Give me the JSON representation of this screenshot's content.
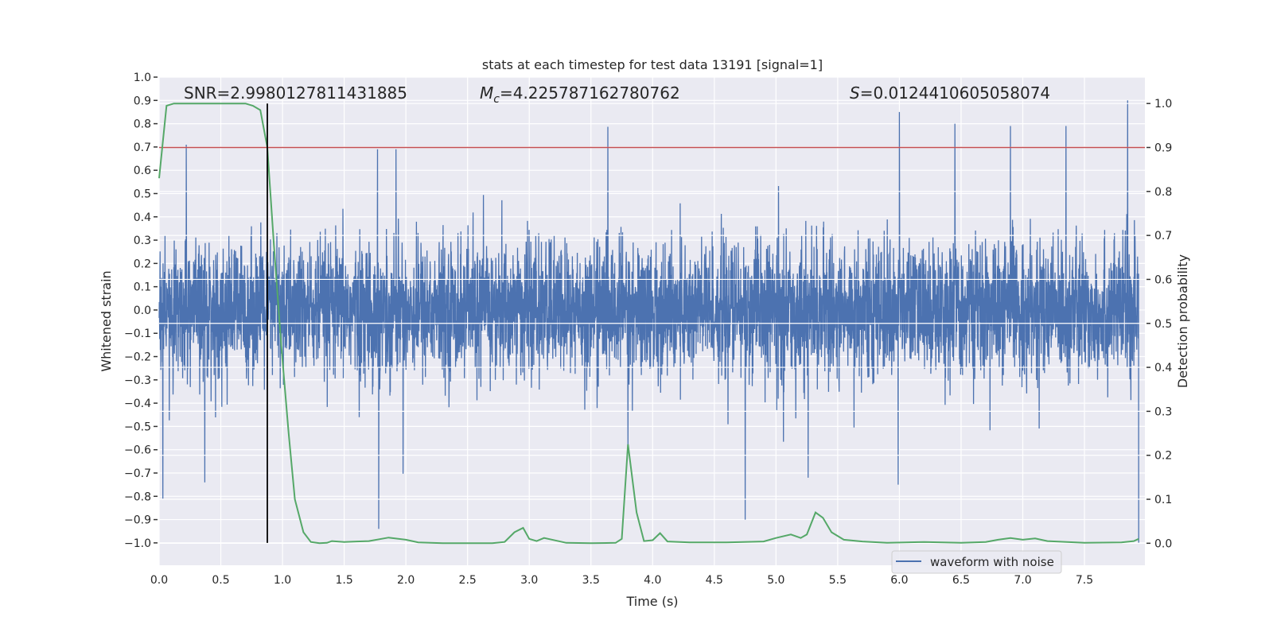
{
  "chart_data": {
    "type": "line",
    "title": "stats at each timestep for test data 13191 [signal=1]",
    "xlabel": "Time (s)",
    "ylabel_left": "Whitened strain",
    "ylabel_right": "Detection probability",
    "xlim": [
      0,
      7.99
    ],
    "ylim_left": [
      -1.096,
      1.0
    ],
    "ylim_right": [
      -0.05,
      1.06
    ],
    "x_ticks": [
      "0.0",
      "0.5",
      "1.0",
      "1.5",
      "2.0",
      "2.5",
      "3.0",
      "3.5",
      "4.0",
      "4.5",
      "5.0",
      "5.5",
      "6.0",
      "6.5",
      "7.0",
      "7.5"
    ],
    "y_ticks_left": [
      "1.0",
      "0.9",
      "0.8",
      "0.7",
      "0.6",
      "0.5",
      "0.4",
      "0.3",
      "0.2",
      "0.1",
      "0.0",
      "−0.1",
      "−0.2",
      "−0.3",
      "−0.4",
      "−0.5",
      "−0.6",
      "−0.7",
      "−0.8",
      "−0.9",
      "−1.0"
    ],
    "y_ticks_right": [
      "1.0",
      "0.9",
      "0.8",
      "0.7",
      "0.6",
      "0.5",
      "0.4",
      "0.3",
      "0.2",
      "0.1",
      "0.0"
    ],
    "grid": true,
    "annotations": {
      "snr": "SNR=2.9980127811431885",
      "mc_symbol": "M",
      "mc_sub": "c",
      "mc_value": "=4.225787162780762",
      "s_symbol": "S",
      "s_value": "=0.0124410605058074"
    },
    "legend": {
      "placement": "lower-right",
      "entries": [
        "waveform with noise"
      ]
    },
    "colors": {
      "waveform": "#4c72b0",
      "probability": "#55a868",
      "threshold": "#c44e52",
      "marker": "#000000",
      "plot_bg": "#eaeaf2"
    },
    "threshold_probability": 0.9,
    "marker_time": 0.877,
    "waveform": {
      "name": "waveform with noise",
      "typical_band": [
        -0.33,
        0.33
      ],
      "notable_peaks": [
        {
          "t": 0.03,
          "v": -0.81
        },
        {
          "t": 0.22,
          "v": 0.71
        },
        {
          "t": 0.37,
          "v": -0.74
        },
        {
          "t": 1.78,
          "v": -0.94
        },
        {
          "t": 1.77,
          "v": 0.69
        },
        {
          "t": 1.92,
          "v": 0.69
        },
        {
          "t": 3.8,
          "v": -0.6
        },
        {
          "t": 4.75,
          "v": -0.9
        },
        {
          "t": 5.26,
          "v": -0.72
        },
        {
          "t": 6.0,
          "v": 0.85
        },
        {
          "t": 5.99,
          "v": -0.75
        },
        {
          "t": 6.45,
          "v": 0.8
        },
        {
          "t": 6.9,
          "v": 0.79
        },
        {
          "t": 7.35,
          "v": 0.79
        },
        {
          "t": 7.85,
          "v": 0.9
        },
        {
          "t": 7.94,
          "v": -1.0
        }
      ]
    },
    "detection_probability": {
      "t": [
        0.0,
        0.06,
        0.12,
        0.7,
        0.76,
        0.82,
        0.877,
        0.93,
        0.99,
        1.05,
        1.1,
        1.17,
        1.23,
        1.3,
        1.36,
        1.4,
        1.5,
        1.6,
        1.7,
        1.86,
        2.0,
        2.1,
        2.3,
        2.5,
        2.7,
        2.8,
        2.88,
        2.95,
        3.0,
        3.06,
        3.12,
        3.3,
        3.5,
        3.7,
        3.75,
        3.8,
        3.87,
        3.93,
        4.0,
        4.06,
        4.12,
        4.3,
        4.6,
        4.9,
        5.0,
        5.12,
        5.2,
        5.25,
        5.32,
        5.38,
        5.45,
        5.55,
        5.7,
        5.9,
        6.2,
        6.5,
        6.7,
        6.8,
        6.9,
        7.0,
        7.1,
        7.2,
        7.5,
        7.8,
        7.9,
        7.94
      ],
      "p": [
        0.83,
        0.995,
        1.0,
        1.0,
        0.995,
        0.985,
        0.9,
        0.68,
        0.45,
        0.25,
        0.1,
        0.025,
        0.003,
        0.0,
        0.001,
        0.005,
        0.003,
        0.004,
        0.005,
        0.013,
        0.008,
        0.002,
        0.0,
        0.0,
        0.0,
        0.003,
        0.025,
        0.035,
        0.01,
        0.005,
        0.012,
        0.001,
        0.0,
        0.001,
        0.01,
        0.225,
        0.07,
        0.005,
        0.007,
        0.023,
        0.004,
        0.002,
        0.002,
        0.004,
        0.012,
        0.02,
        0.012,
        0.02,
        0.07,
        0.058,
        0.025,
        0.008,
        0.004,
        0.001,
        0.003,
        0.001,
        0.003,
        0.008,
        0.012,
        0.008,
        0.011,
        0.005,
        0.001,
        0.002,
        0.005,
        0.01
      ]
    }
  }
}
